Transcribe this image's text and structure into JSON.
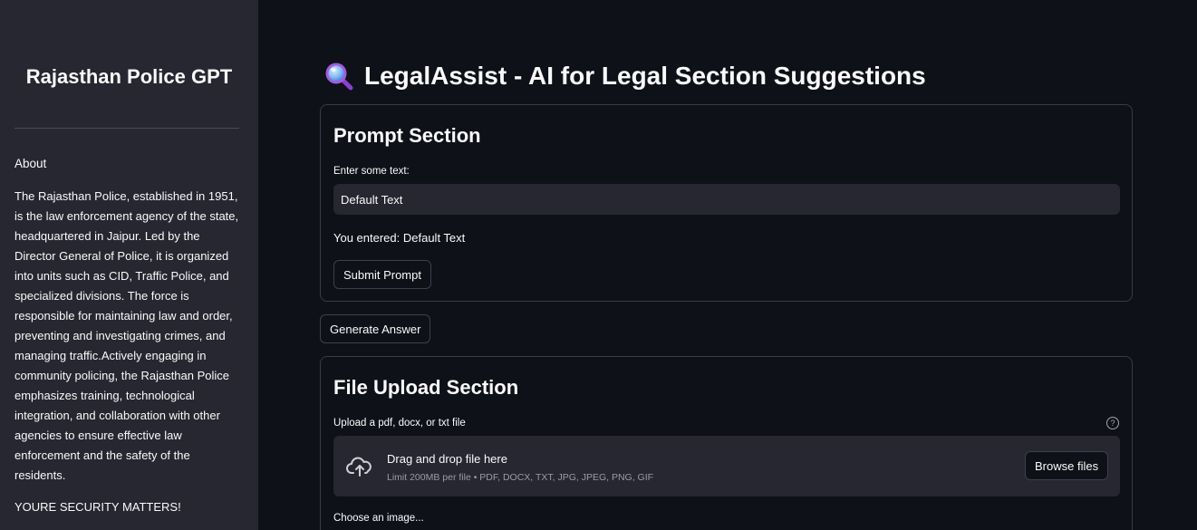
{
  "sidebar": {
    "title": "Rajasthan Police GPT",
    "about_label": "About",
    "description": "The Rajasthan Police, established in 1951, is the law enforcement agency of the state, headquartered in Jaipur. Led by the Director General of Police, it is organized into units such as CID, Traffic Police, and specialized divisions. The force is responsible for maintaining law and order, preventing and investigating crimes, and managing traffic.Actively engaging in community policing, the Rajasthan Police emphasizes training, technological integration, and collaboration with other agencies to ensure effective law enforcement and the safety of the residents.",
    "footer": "YOURE SECURITY MATTERS!"
  },
  "main": {
    "title_icon": "magnifying-glass-icon",
    "title": "LegalAssist - AI for Legal Section Suggestions"
  },
  "prompt_section": {
    "heading": "Prompt Section",
    "input_label": "Enter some text:",
    "input_value": "Default Text",
    "echo": "You entered: Default Text",
    "submit_label": "Submit Prompt"
  },
  "generate_label": "Generate Answer",
  "upload_section": {
    "heading": "File Upload Section",
    "label": "Upload a pdf, docx, or txt file",
    "help_icon": "question-circle-icon",
    "upload_icon": "cloud-upload-icon",
    "dropzone_title": "Drag and drop file here",
    "dropzone_sub": "Limit 200MB per file • PDF, DOCX, TXT, JPG, JPEG, PNG, GIF",
    "browse_label": "Browse files",
    "image_label": "Choose an image..."
  },
  "colors": {
    "background": "#0e1117",
    "sidebar": "#262730",
    "input": "#262730",
    "text": "#fafafa"
  }
}
